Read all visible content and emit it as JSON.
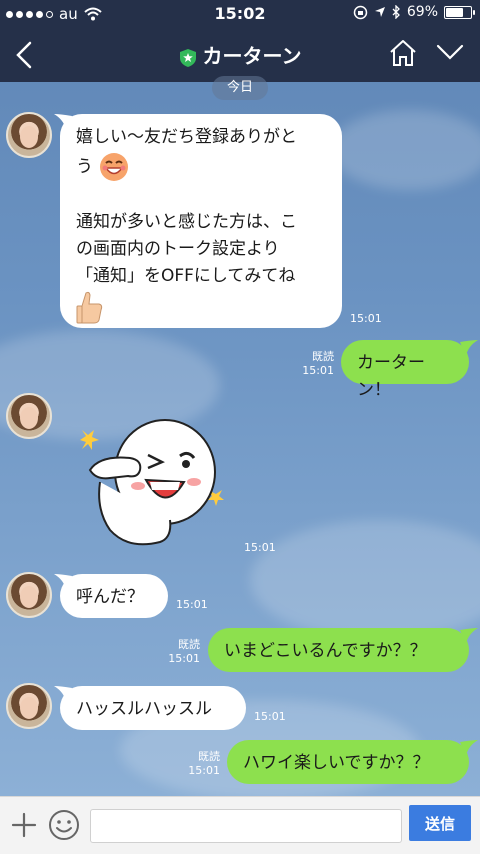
{
  "status_bar": {
    "carrier": "au",
    "time": "15:02",
    "battery": "69%",
    "battery_level": 0.69
  },
  "header": {
    "title": "カーターン",
    "icons": {
      "back": "chevron-left-icon",
      "official": "shield-star-icon",
      "home": "home-icon",
      "menu": "chevron-down-icon"
    }
  },
  "date_divider": "今日",
  "messages": [
    {
      "side": "in",
      "text1": "嬉しい〜友だち登録ありがと",
      "text2": "う",
      "text3": "通知が多いと感じた方は、こ",
      "text4": "の画面内のトーク設定より",
      "text5": "「通知」をOFFにしてみてね",
      "time": "15:01"
    },
    {
      "side": "out",
      "text": "カーターン！",
      "read": "既読",
      "time": "15:01"
    },
    {
      "side": "in",
      "type": "sticker",
      "time": "15:01"
    },
    {
      "side": "in",
      "text": "呼んだ？",
      "time": "15:01"
    },
    {
      "side": "out",
      "text": "いまどこいるんですか？？",
      "read": "既読",
      "time": "15:01"
    },
    {
      "side": "in",
      "text": "ハッスルハッスル",
      "time": "15:01"
    },
    {
      "side": "out",
      "text": "ハワイ楽しいですか？？",
      "read": "既読",
      "time": "15:01"
    }
  ],
  "input": {
    "placeholder": "",
    "send_label": "送信"
  },
  "colors": {
    "header_bg": "#253049",
    "bubble_out": "#8de04e",
    "bubble_in": "#ffffff",
    "send_button": "#3b7ce0"
  }
}
